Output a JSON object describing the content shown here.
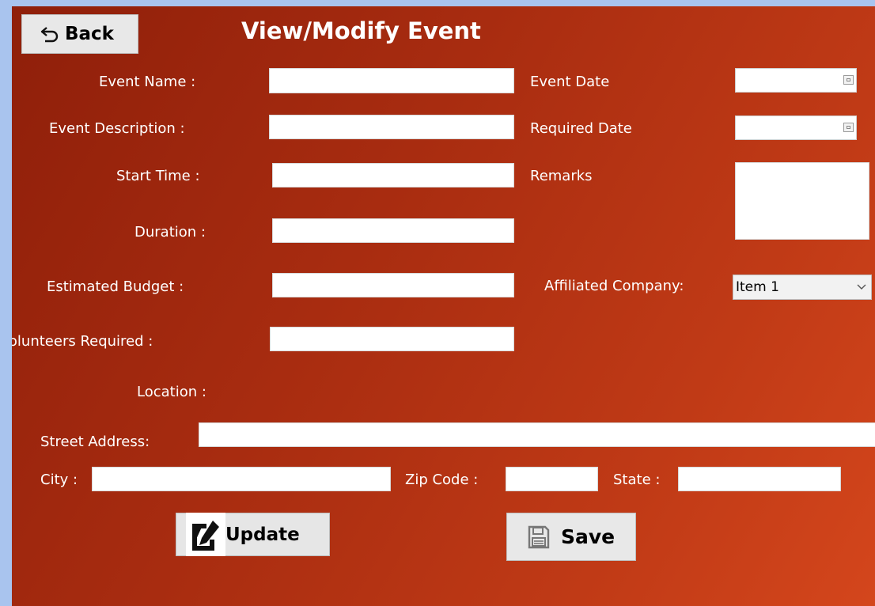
{
  "header": {
    "back_label": "Back",
    "title": "View/Modify Event"
  },
  "form": {
    "event_name_label": "Event Name :",
    "event_name_value": "",
    "event_description_label": "Event Description :",
    "event_description_value": "",
    "start_time_label": "Start Time :",
    "start_time_value": "",
    "duration_label": "Duration :",
    "duration_value": "",
    "estimated_budget_label": "Estimated Budget :",
    "estimated_budget_value": "",
    "volunteers_required_label": "Volunteers Required :",
    "volunteers_required_value": "",
    "location_label": "Location :",
    "event_date_label": "Event Date",
    "event_date_value": "",
    "required_date_label": "Required Date",
    "required_date_value": "",
    "remarks_label": "Remarks",
    "remarks_value": "",
    "affiliated_company_label": "Affiliated Company:",
    "affiliated_company_selected": "Item 1",
    "street_address_label": "Street Address:",
    "street_address_value": "",
    "city_label": "City :",
    "city_value": "",
    "zip_code_label": "Zip Code :",
    "zip_code_value": "",
    "state_label": "State :",
    "state_value": ""
  },
  "actions": {
    "update_label": "Update",
    "save_label": "Save"
  },
  "icons": {
    "back": "undo-arrow-icon",
    "update": "edit-icon",
    "save": "floppy-disk-icon",
    "calendar": "calendar-icon",
    "dropdown": "chevron-down-icon"
  },
  "colors": {
    "background_frame": "#a9c4ee",
    "panel_dark": "#8f1f0a",
    "panel_light": "#d4461c",
    "label_text": "#ffffff"
  }
}
